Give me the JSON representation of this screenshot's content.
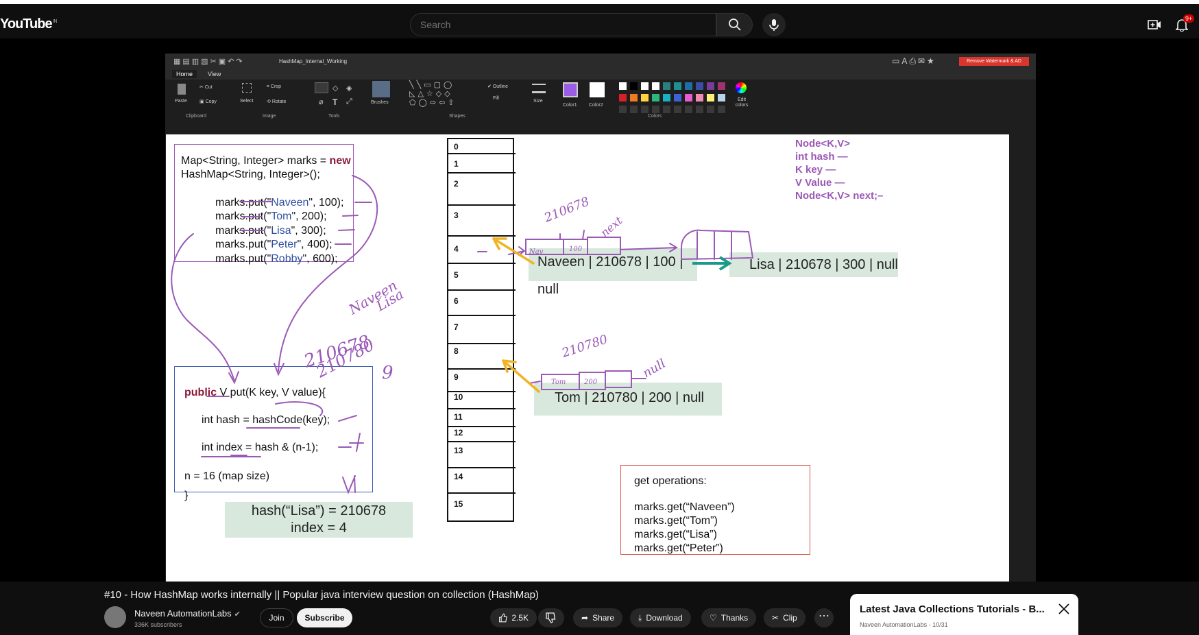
{
  "header": {
    "logo": "YouTube",
    "region": "IN",
    "search_placeholder": "Search",
    "notification_count": "9+"
  },
  "paint": {
    "file_name": "HashMap_Internal_Working",
    "watermark_button": "Remove Watermark & AD",
    "tabs": [
      "Home",
      "View"
    ],
    "labels": {
      "cut": "Cut",
      "copy": "Copy",
      "paste": "Paste",
      "select": "Select",
      "crop": "Crop",
      "rotate": "Rotate",
      "brushes": "Brushes",
      "outline": "Outline",
      "fill": "Fill",
      "size": "Size",
      "color1": "Color1",
      "color2": "Color2",
      "edit_colors": "Edit colors"
    },
    "groups": [
      "Clipboard",
      "Image",
      "Tools",
      "Shapes",
      "Colors"
    ],
    "colors": {
      "color1": "#9b5de5",
      "color2": "#ffffff"
    },
    "palette": [
      "#ffffff",
      "#000000",
      "#ffffff",
      "#ffffff",
      "#2a7f7f",
      "#1f8f8f",
      "#1d6fa5",
      "#3b4ea6",
      "#7a3b9b",
      "#a0336f",
      "#d4202a",
      "#f07a22",
      "#ffd23f",
      "#2eb67d",
      "#1ab0c4",
      "#3c63d6",
      "#e85bd1",
      "#f28ab3",
      "#fff07a",
      "#b8d4e8"
    ]
  },
  "code": {
    "line1_a": "Map<String, Integer> marks = ",
    "line1_kw": "new",
    "line2": "HashMap<String, Integer>();",
    "puts": [
      {
        "pre": "marks.put(\"",
        "key": "Naveen",
        "post": "\", 100);"
      },
      {
        "pre": "marks.put(\"",
        "key": "Tom",
        "post": "\", 200);"
      },
      {
        "pre": "marks.put(\"",
        "key": "Lisa",
        "post": "\", 300);"
      },
      {
        "pre": "marks.put(\"",
        "key": "Peter",
        "post": "\", 400);"
      },
      {
        "pre": "marks.put(\"",
        "key": "Robby",
        "post": "\", 600);"
      }
    ],
    "method_kw": "public",
    "method_sig": " V put(K key, V value){",
    "hash_line": "int hash = hashCode(key);",
    "index_line": "int index = hash & (n-1);",
    "n_line": "n = 16 (map size)",
    "close_brace": "}"
  },
  "hash_box": {
    "line1": "hash(“Lisa”) = 210678",
    "line2": "index =  4"
  },
  "buckets": [
    "0",
    "1",
    "2",
    "3",
    "4",
    "5",
    "6",
    "7",
    "8",
    "9",
    "10",
    "11",
    "12",
    "13",
    "14",
    "15"
  ],
  "nodes": {
    "naveen": "Naveen | 210678 | 100 | null",
    "lisa": "Lisa | 210678 | 300 | null",
    "tom": "Tom | 210780 | 200 | null"
  },
  "node_spec": [
    "Node<K,V>",
    "int hash  —",
    "K key  —",
    "V Value  —",
    "Node<K,V> next;–"
  ],
  "get_ops": {
    "title": "get operations:",
    "lines": [
      "marks.get(“Naveen”)",
      "marks.get(“Tom”)",
      "marks.get(“Lisa”)",
      "marks.get(“Peter”)"
    ]
  },
  "video": {
    "title": "#10 - How HashMap works internally || Popular java interview question on collection (HashMap)",
    "channel": "Naveen AutomationLabs",
    "subscribers": "336K subscribers",
    "join": "Join",
    "subscribe": "Subscribe",
    "likes": "2.5K",
    "share": "Share",
    "download": "Download",
    "thanks": "Thanks",
    "clip": "Clip"
  },
  "playlist": {
    "title": "Latest Java Collections Tutorials - B...",
    "subtitle": "Naveen AutomationLabs - 10/31"
  }
}
